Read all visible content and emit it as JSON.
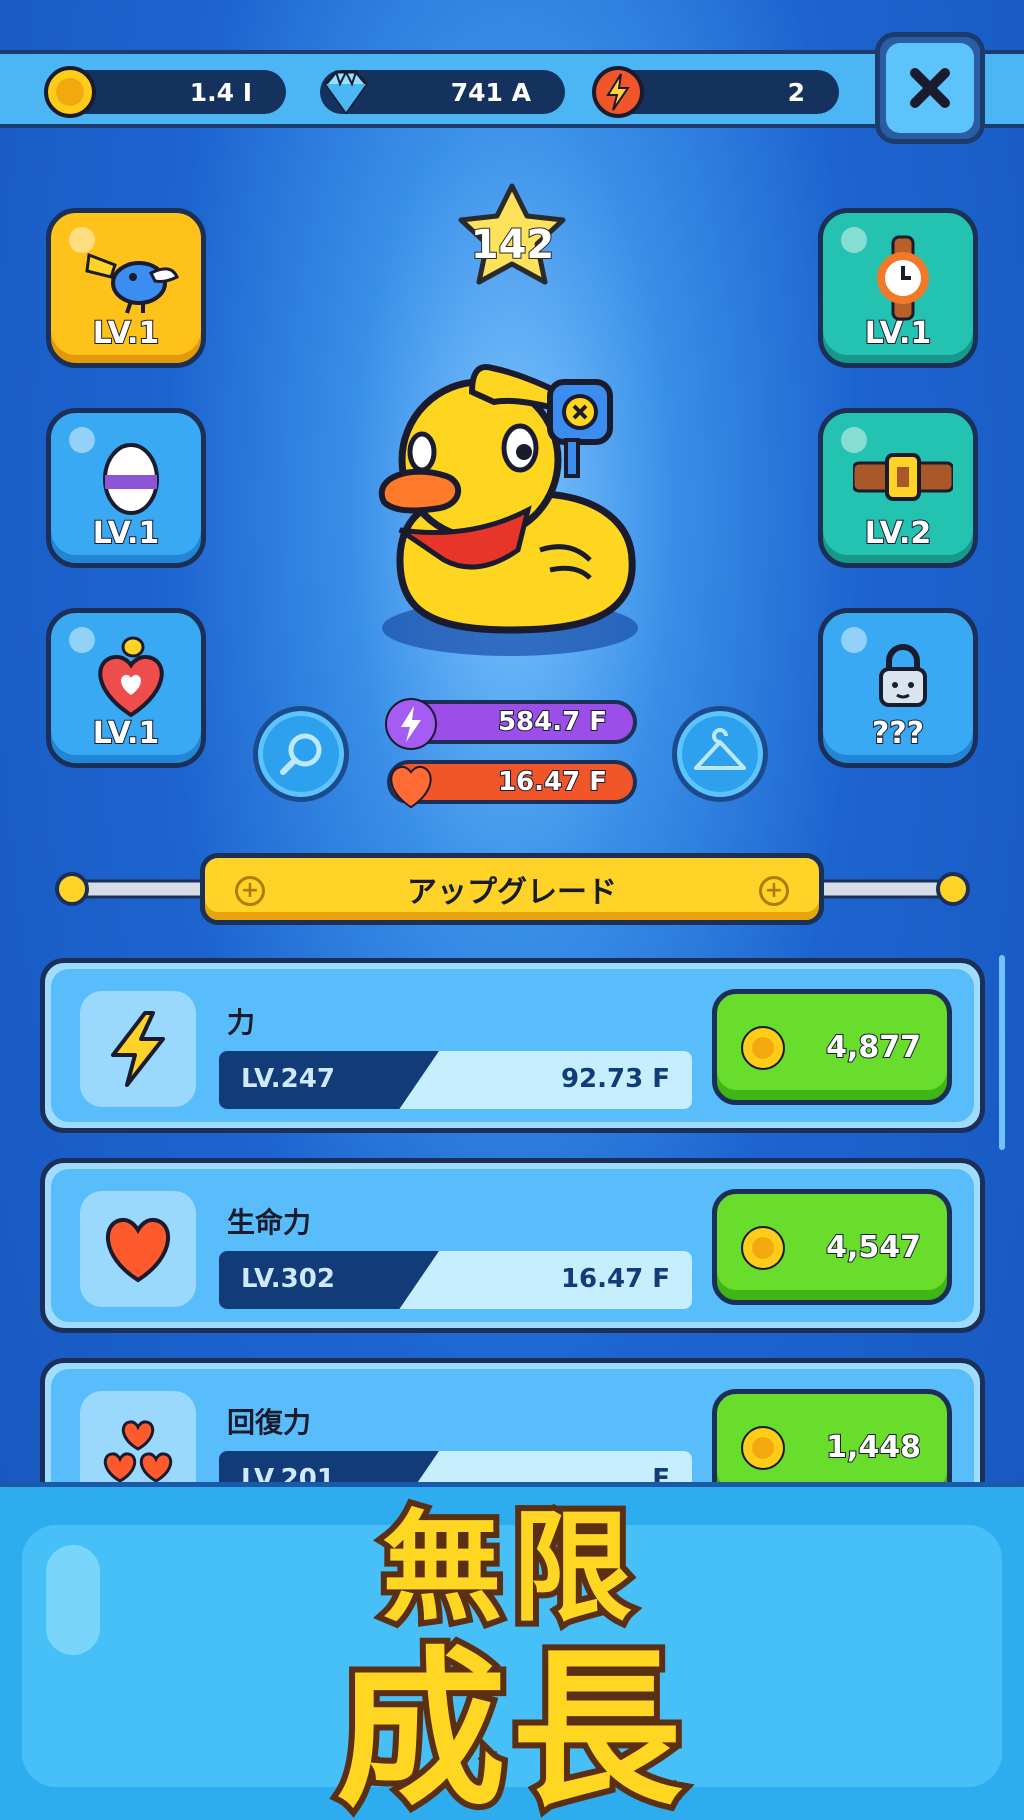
{
  "currency": {
    "coins": "1.4 I",
    "gems": "741 A",
    "energy": "2"
  },
  "hero": {
    "level": "142",
    "power": "584.7 F",
    "health": "16.47 F"
  },
  "slots": {
    "bird": "LV.1",
    "egg": "LV.1",
    "heart": "LV.1",
    "watch": "LV.1",
    "belt": "LV.2",
    "locked": "???"
  },
  "upgrade_header": "アップグレード",
  "upgrades": [
    {
      "name": "力",
      "level": "LV.247",
      "value": "92.73 F",
      "cost": "4,877"
    },
    {
      "name": "生命力",
      "level": "LV.302",
      "value": "16.47 F",
      "cost": "4,547"
    },
    {
      "name": "回復力",
      "level": "LV.201",
      "value": "F",
      "cost": "1,448"
    }
  ],
  "promo": {
    "line1": "無限",
    "line2": "成長"
  },
  "colors": {
    "background": "#1d64cf",
    "topbar": "#4cb6f4",
    "buy_button": "#68dd2c",
    "header_gold": "#ffd327",
    "promo_text": "#ffd622"
  }
}
